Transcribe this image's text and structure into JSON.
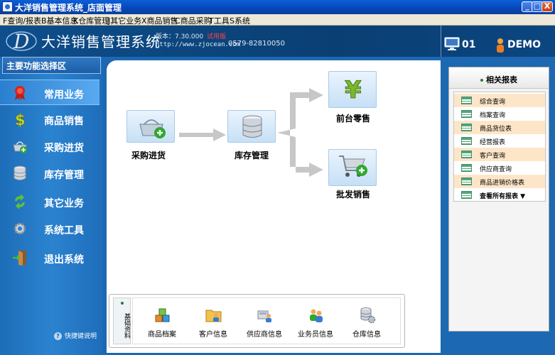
{
  "window": {
    "title": "大洋销售管理系统_店面管理",
    "minimize": "_",
    "maximize": "□",
    "close": "X"
  },
  "menu": [
    {
      "label": "F查询/报表"
    },
    {
      "label": "B基本信息"
    },
    {
      "label": "K仓库管理"
    },
    {
      "label": "J其它业务"
    },
    {
      "label": "X商品销售"
    },
    {
      "label": "C商品采购"
    },
    {
      "label": "T工具"
    },
    {
      "label": "S系统"
    }
  ],
  "header": {
    "system_name": "大洋销售管理系统",
    "version": "版本：7.30.000",
    "version_badge": "试用版",
    "url": "http://www.zjocean.com",
    "phone": "0579-82810050",
    "terminal": "01",
    "user": "DEMO"
  },
  "sidebar": {
    "heading": "主要功能选择区",
    "items": [
      {
        "label": "常用业务",
        "icon": "award-ribbon-icon",
        "active": true
      },
      {
        "label": "商品销售",
        "icon": "dollar-icon"
      },
      {
        "label": "采购进货",
        "icon": "basket-icon"
      },
      {
        "label": "库存管理",
        "icon": "database-icon"
      },
      {
        "label": "其它业务",
        "icon": "refresh-arrows-icon"
      },
      {
        "label": "系统工具",
        "icon": "gear-icon"
      },
      {
        "label": "退出系统",
        "icon": "exit-door-icon"
      }
    ],
    "help_text": "快捷键说明"
  },
  "flow": {
    "purchase": "采购进货",
    "inventory": "库存管理",
    "retail": "前台零售",
    "wholesale": "批发销售"
  },
  "reports": {
    "heading": "相关报表",
    "items": [
      {
        "label": "综合查询",
        "highlight": true
      },
      {
        "label": "档案查询",
        "highlight": false
      },
      {
        "label": "商品货位表",
        "highlight": true
      },
      {
        "label": "经营报表",
        "highlight": false
      },
      {
        "label": "客户查询",
        "highlight": true
      },
      {
        "label": "供应商查询",
        "highlight": false
      },
      {
        "label": "商品进销价格表",
        "highlight": true
      }
    ],
    "more": "查看所有报表 ▼"
  },
  "basic_info": {
    "tab": "基础资料",
    "items": [
      {
        "label": "商品档案",
        "icon": "product-boxes-icon"
      },
      {
        "label": "客户信息",
        "icon": "customer-folder-icon"
      },
      {
        "label": "供应商信息",
        "icon": "supplier-icon"
      },
      {
        "label": "业务员信息",
        "icon": "staff-icon"
      },
      {
        "label": "仓库信息",
        "icon": "warehouse-db-icon"
      }
    ]
  },
  "colors": {
    "sidebar": "#2b83cf",
    "header": "#0e4e8c",
    "main_bg": "#1c68b2",
    "report_highlight": "#fde6c8"
  }
}
